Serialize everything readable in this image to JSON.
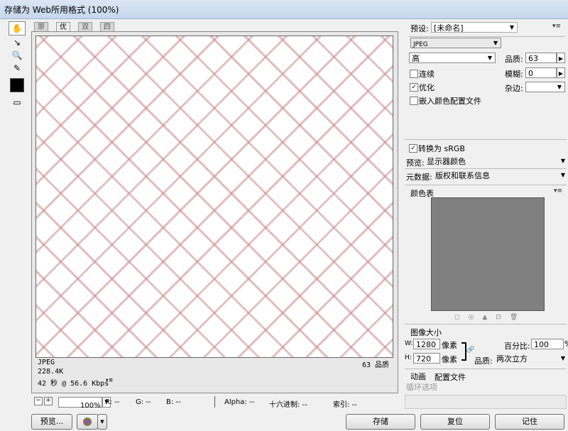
{
  "window": {
    "title": "存储为 Web所用格式 (100%)"
  },
  "tabs": [
    {
      "label": "原稿"
    },
    {
      "label": "优化"
    },
    {
      "label": "双联"
    },
    {
      "label": "四联"
    }
  ],
  "image_info": {
    "format": "JPEG",
    "size": "228.4K",
    "time": "42 秒 @ 56.6 Kbps",
    "quality_note": "63 品质"
  },
  "statusbar": {
    "zoom": "100%",
    "r": "R: --",
    "g": "G: --",
    "b": "B: --",
    "alpha": "Alpha: --",
    "hex": "十六进制: --",
    "index": "索引: --"
  },
  "buttons": {
    "preview": "预览...",
    "save": "存储",
    "reset": "复位",
    "remember": "记住"
  },
  "settings": {
    "preset_label": "预设:",
    "preset_value": "[未命名]",
    "format_value": "JPEG",
    "quality_level": "高",
    "quality_label": "品质:",
    "quality_value": "63",
    "progressive_label": "连续",
    "blur_label": "模糊:",
    "blur_value": "0",
    "optimized_label": "优化",
    "matte_label": "杂边:",
    "embed_profile_label": "嵌入颜色配置文件",
    "convert_srgb_label": "转换为 sRGB",
    "preview_label": "预览:",
    "preview_value": "显示器颜色",
    "metadata_label": "元数据:",
    "metadata_value": "版权和联系信息",
    "color_table_label": "颜色表"
  },
  "image_size": {
    "section_label": "图像大小",
    "w_label": "W:",
    "w_value": "1280",
    "w_unit": "像素",
    "h_label": "H:",
    "h_value": "720",
    "h_unit": "像素",
    "percent_label": "百分比:",
    "percent_value": "100",
    "percent_unit": "%",
    "quality_label": "品质:",
    "quality_value": "两次立方"
  },
  "animation": {
    "section_label": "动画",
    "profile_label": "配置文件",
    "loop_label": "循环选项"
  },
  "colors": {
    "accent": "#c98a8a",
    "color_table_bg": "#808080"
  }
}
